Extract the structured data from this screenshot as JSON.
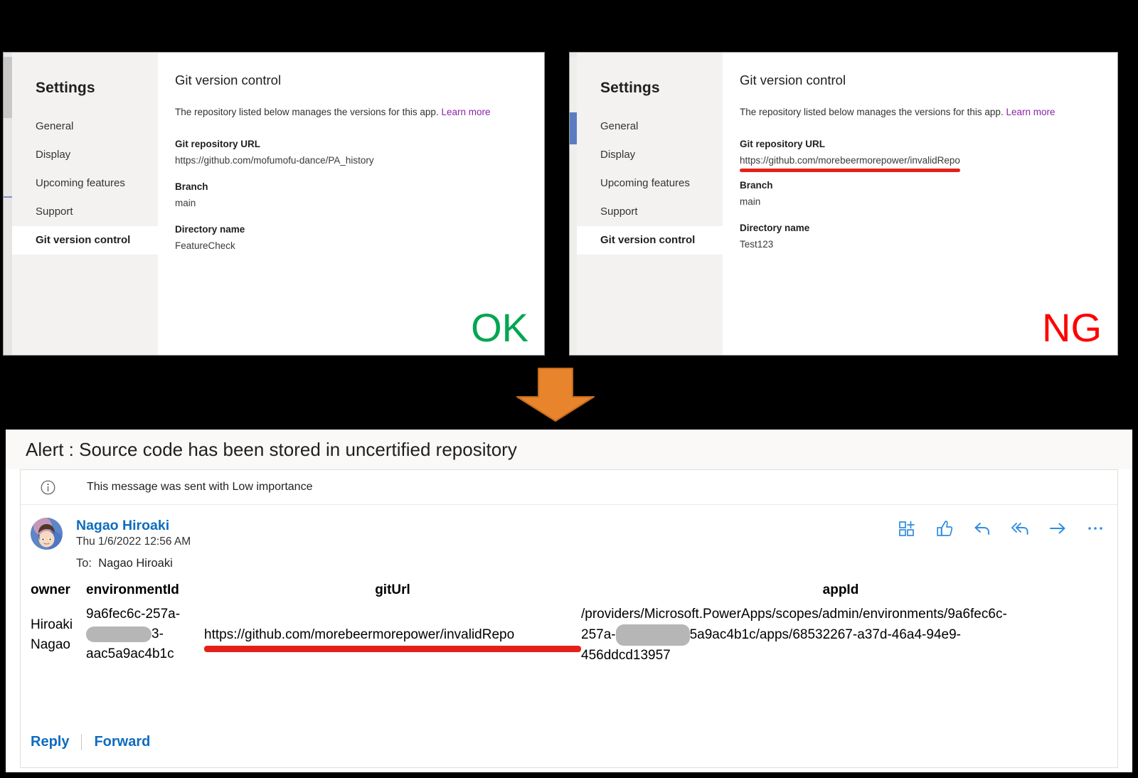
{
  "panels": [
    {
      "id": "ok",
      "nav_title": "Settings",
      "nav_items": [
        "General",
        "Display",
        "Upcoming features",
        "Support",
        "Git version control"
      ],
      "selected_nav": "Git version control",
      "heading": "Git version control",
      "description": "The repository listed below manages the versions for this app.",
      "learn_more": "Learn more",
      "fields": [
        {
          "label": "Git repository URL",
          "value": "https://github.com/mofumofu-dance/PA_history",
          "struck": false
        },
        {
          "label": "Branch",
          "value": "main",
          "struck": false
        },
        {
          "label": "Directory name",
          "value": "FeatureCheck",
          "struck": false
        }
      ],
      "verdict": "OK",
      "verdict_color": "#00a651"
    },
    {
      "id": "ng",
      "nav_title": "Settings",
      "nav_items": [
        "General",
        "Display",
        "Upcoming features",
        "Support",
        "Git version control"
      ],
      "selected_nav": "Git version control",
      "heading": "Git version control",
      "description": "The repository listed below manages the versions for this app.",
      "learn_more": "Learn more",
      "fields": [
        {
          "label": "Git repository URL",
          "value": "https://github.com/morebeermorepower/invalidRepo",
          "struck": true
        },
        {
          "label": "Branch",
          "value": "main",
          "struck": false
        },
        {
          "label": "Directory name",
          "value": "Test123",
          "struck": false
        }
      ],
      "verdict": "NG",
      "verdict_color": "#ff0000"
    }
  ],
  "flow_arrow": {
    "icon": "down-arrow-icon",
    "color": "#e8842b"
  },
  "email": {
    "subject": "Alert : Source code has been stored in uncertified repository",
    "importance_icon": "info-icon",
    "importance_text": "This message was sent with Low importance",
    "sender": "Nagao Hiroaki",
    "sent_time": "Thu 1/6/2022 12:56 AM",
    "to_label": "To:",
    "to_value": "Nagao Hiroaki",
    "actions": [
      {
        "name": "add-to-grid-icon"
      },
      {
        "name": "thumbs-up-icon"
      },
      {
        "name": "reply-icon"
      },
      {
        "name": "reply-all-icon"
      },
      {
        "name": "forward-icon"
      },
      {
        "name": "more-options-icon"
      }
    ],
    "table": {
      "headers": [
        "owner",
        "environmentId",
        "gitUrl",
        "appId"
      ],
      "row": {
        "owner": "Hiroaki Nagao",
        "environment_id_prefix": "9a6fec6c-257a-",
        "environment_id_redacted_suffix": "3-",
        "environment_id_tail": "aac5a9ac4b1c",
        "git_url": "https://github.com/morebeermorepower/invalidRepo",
        "app_id_line1": "/providers/Microsoft.PowerApps/scopes/admin/environments/9a6fec6c-",
        "app_id_line2_prefix": "257a-",
        "app_id_line2_suffix": "5a9ac4b1c/apps/68532267-a37d-46a4-94e9-",
        "app_id_line3": "456ddcd13957"
      }
    },
    "reply_label": "Reply",
    "forward_label": "Forward"
  },
  "colors": {
    "red_strike": "#e32119",
    "link_blue": "#0f6cbd",
    "learn_more_purple": "#8b23a8",
    "arrow_orange": "#e8842b"
  }
}
